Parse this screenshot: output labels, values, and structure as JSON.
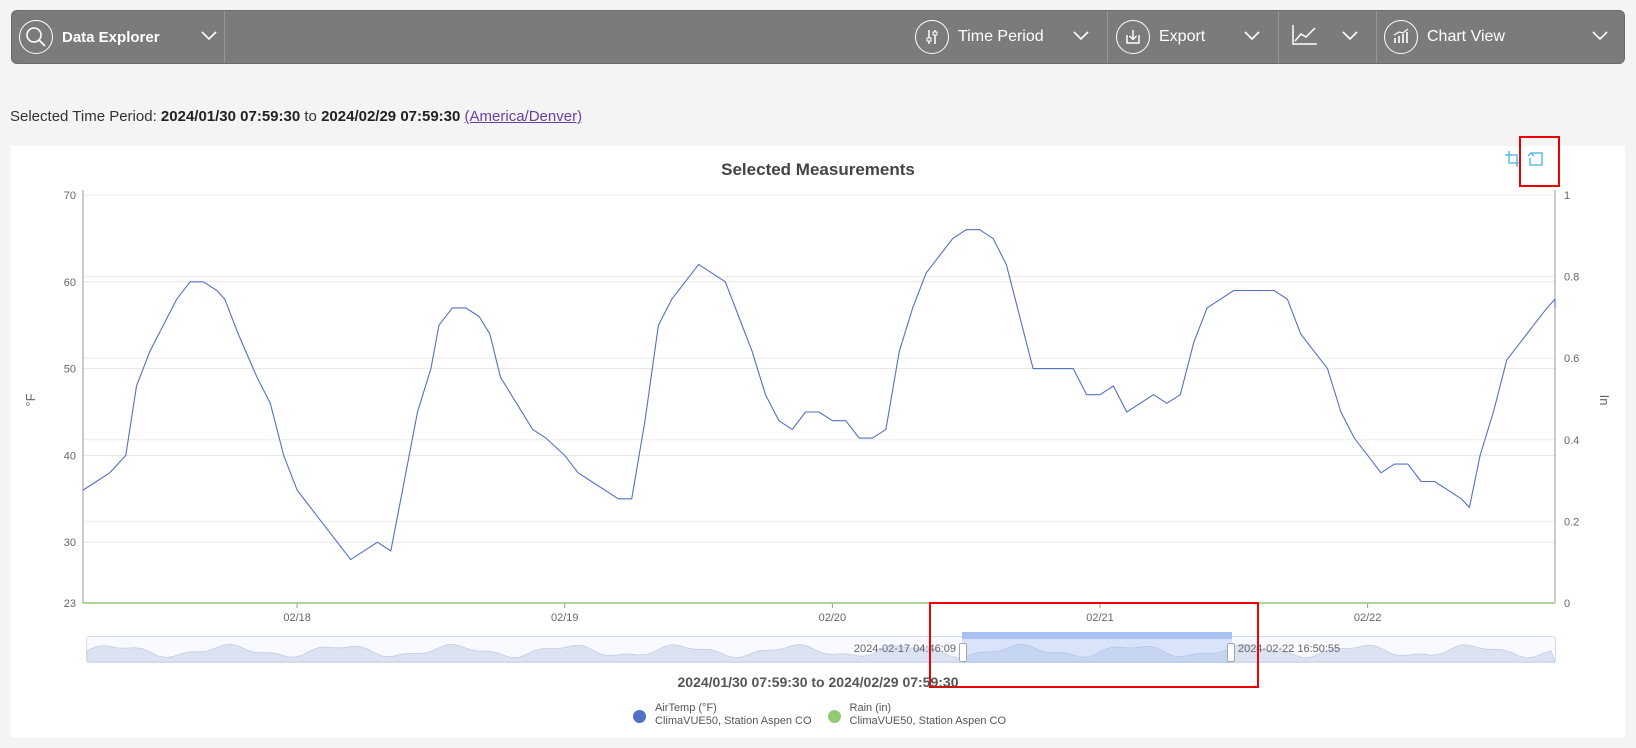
{
  "toolbar": {
    "data_explorer": "Data Explorer",
    "time_period": "Time Period",
    "export": "Export",
    "chart_view": "Chart View"
  },
  "period": {
    "prefix": "Selected Time Period: ",
    "start": "2024/01/30 07:59:30",
    "to": " to ",
    "end": "2024/02/29 07:59:30",
    "timezone": "(America/Denver)"
  },
  "chart": {
    "title": "Selected Measurements",
    "y_left_label": "°F",
    "y_right_label": "In",
    "zoom_start": "2024-02-17 04:46:09",
    "zoom_end": "2024-02-22 16:50:55",
    "range_text": "2024/01/30 07:59:30 to 2024/02/29 07:59:30"
  },
  "legend": [
    {
      "name": "AirTemp (°F)",
      "station": "ClimaVUE50, Station Aspen CO",
      "color": "#5470c6"
    },
    {
      "name": "Rain (in)",
      "station": "ClimaVUE50, Station Aspen CO",
      "color": "#91cc75"
    }
  ],
  "chart_data": {
    "type": "line",
    "title": "Selected Measurements",
    "x_ticks": [
      "02/18",
      "02/19",
      "02/20",
      "02/21",
      "02/22"
    ],
    "y_left": {
      "label": "°F",
      "ticks": [
        23,
        30,
        40,
        50,
        60,
        70
      ],
      "range": [
        23,
        70
      ]
    },
    "y_right": {
      "label": "In",
      "ticks": [
        0,
        0.2,
        0.4,
        0.6,
        0.8,
        1
      ],
      "range": [
        0,
        1
      ]
    },
    "x_range_days": [
      -0.8,
      4.7
    ],
    "series": [
      {
        "name": "AirTemp (°F)",
        "axis": "left",
        "color": "#5470c6",
        "points": [
          [
            -0.8,
            36
          ],
          [
            -0.75,
            37
          ],
          [
            -0.7,
            38
          ],
          [
            -0.64,
            40
          ],
          [
            -0.6,
            48
          ],
          [
            -0.55,
            52
          ],
          [
            -0.5,
            55
          ],
          [
            -0.45,
            58
          ],
          [
            -0.4,
            60
          ],
          [
            -0.35,
            60
          ],
          [
            -0.3,
            59
          ],
          [
            -0.27,
            58
          ],
          [
            -0.22,
            54
          ],
          [
            -0.15,
            49
          ],
          [
            -0.1,
            46
          ],
          [
            -0.05,
            40
          ],
          [
            0,
            36
          ],
          [
            0.05,
            34
          ],
          [
            0.1,
            32
          ],
          [
            0.15,
            30
          ],
          [
            0.2,
            28
          ],
          [
            0.25,
            29
          ],
          [
            0.3,
            30
          ],
          [
            0.35,
            29
          ],
          [
            0.4,
            37
          ],
          [
            0.45,
            45
          ],
          [
            0.5,
            50
          ],
          [
            0.53,
            55
          ],
          [
            0.58,
            57
          ],
          [
            0.63,
            57
          ],
          [
            0.68,
            56
          ],
          [
            0.72,
            54
          ],
          [
            0.76,
            49
          ],
          [
            0.82,
            46
          ],
          [
            0.88,
            43
          ],
          [
            0.93,
            42
          ],
          [
            1.0,
            40
          ],
          [
            1.05,
            38
          ],
          [
            1.1,
            37
          ],
          [
            1.15,
            36
          ],
          [
            1.2,
            35
          ],
          [
            1.25,
            35
          ],
          [
            1.3,
            44
          ],
          [
            1.35,
            55
          ],
          [
            1.4,
            58
          ],
          [
            1.45,
            60
          ],
          [
            1.5,
            62
          ],
          [
            1.55,
            61
          ],
          [
            1.6,
            60
          ],
          [
            1.65,
            56
          ],
          [
            1.7,
            52
          ],
          [
            1.75,
            47
          ],
          [
            1.8,
            44
          ],
          [
            1.85,
            43
          ],
          [
            1.9,
            45
          ],
          [
            1.95,
            45
          ],
          [
            2.0,
            44
          ],
          [
            2.05,
            44
          ],
          [
            2.1,
            42
          ],
          [
            2.15,
            42
          ],
          [
            2.2,
            43
          ],
          [
            2.25,
            52
          ],
          [
            2.3,
            57
          ],
          [
            2.35,
            61
          ],
          [
            2.4,
            63
          ],
          [
            2.45,
            65
          ],
          [
            2.5,
            66
          ],
          [
            2.55,
            66
          ],
          [
            2.6,
            65
          ],
          [
            2.65,
            62
          ],
          [
            2.7,
            56
          ],
          [
            2.75,
            50
          ],
          [
            2.8,
            50
          ],
          [
            2.85,
            50
          ],
          [
            2.9,
            50
          ],
          [
            2.95,
            47
          ],
          [
            3.0,
            47
          ],
          [
            3.05,
            48
          ],
          [
            3.1,
            45
          ],
          [
            3.15,
            46
          ],
          [
            3.2,
            47
          ],
          [
            3.25,
            46
          ],
          [
            3.3,
            47
          ],
          [
            3.35,
            53
          ],
          [
            3.4,
            57
          ],
          [
            3.45,
            58
          ],
          [
            3.5,
            59
          ],
          [
            3.55,
            59
          ],
          [
            3.6,
            59
          ],
          [
            3.65,
            59
          ],
          [
            3.7,
            58
          ],
          [
            3.75,
            54
          ],
          [
            3.8,
            52
          ],
          [
            3.85,
            50
          ],
          [
            3.9,
            45
          ],
          [
            3.95,
            42
          ],
          [
            4.0,
            40
          ],
          [
            4.05,
            38
          ],
          [
            4.1,
            39
          ],
          [
            4.15,
            39
          ],
          [
            4.2,
            37
          ],
          [
            4.25,
            37
          ],
          [
            4.3,
            36
          ],
          [
            4.35,
            35
          ],
          [
            4.38,
            34
          ],
          [
            4.42,
            40
          ],
          [
            4.47,
            45
          ],
          [
            4.52,
            51
          ],
          [
            4.57,
            53
          ],
          [
            4.62,
            55
          ],
          [
            4.67,
            57
          ],
          [
            4.7,
            58
          ],
          [
            4.74,
            57
          ]
        ]
      },
      {
        "name": "Rain (in)",
        "axis": "right",
        "color": "#91cc75",
        "points": [
          [
            -0.8,
            0
          ],
          [
            4.74,
            0
          ]
        ]
      }
    ]
  }
}
